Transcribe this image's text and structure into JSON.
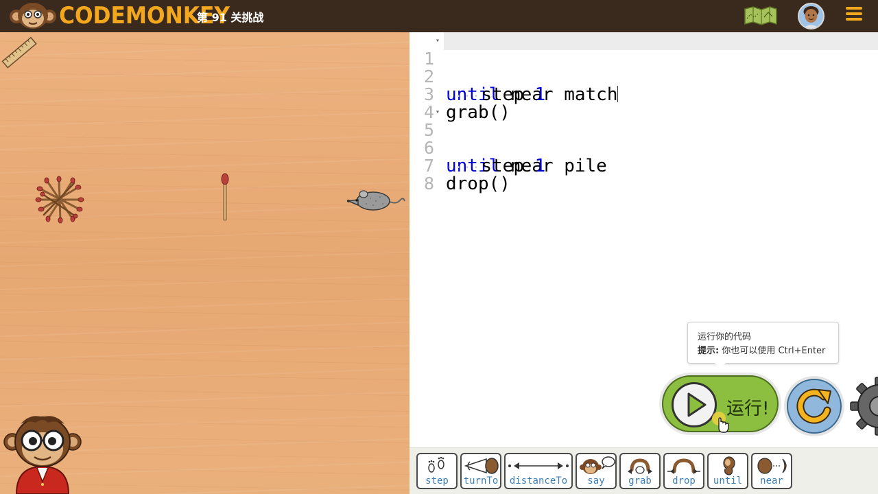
{
  "app": {
    "logo_text": "codemonkey",
    "level_title": "第 91 关挑战"
  },
  "editor": {
    "lines": [
      {
        "num": "1",
        "text": "until near match"
      },
      {
        "num": "2",
        "text": "step 1"
      },
      {
        "num": "3",
        "text": "grab()"
      },
      {
        "num": "4",
        "text": ""
      },
      {
        "num": "5",
        "text": "until near pile"
      },
      {
        "num": "6",
        "text": "step 1"
      },
      {
        "num": "7",
        "text": "drop()"
      },
      {
        "num": "8",
        "text": ""
      }
    ],
    "l1": {
      "kw": "until",
      "rest": " near match"
    },
    "l2": {
      "dots": "····",
      "fn": "step ",
      "num": "1"
    },
    "l3": {
      "text": "grab()"
    },
    "l5": {
      "kw": "until",
      "rest": " near pile"
    },
    "l6": {
      "dots": "····",
      "fn": "step ",
      "num": "1"
    },
    "l7": {
      "text": "drop()"
    }
  },
  "tooltip": {
    "line1": "运行你的代码",
    "hint_label": "提示:",
    "hint_text": " 你也可以使用 Ctrl+Enter"
  },
  "run": {
    "label": "运行!"
  },
  "toolbar": {
    "tools": [
      "step",
      "turnTo",
      "distanceTo",
      "say",
      "grab",
      "drop",
      "until",
      "near"
    ]
  },
  "colors": {
    "topbar": "#3a2a1e",
    "logo": "#f3a71f",
    "board": "#e9ad79",
    "run": "#8cbf3f",
    "reset": "#8fb8dc",
    "keyword": "#0000d8",
    "tool_label": "#3d7fb5"
  }
}
